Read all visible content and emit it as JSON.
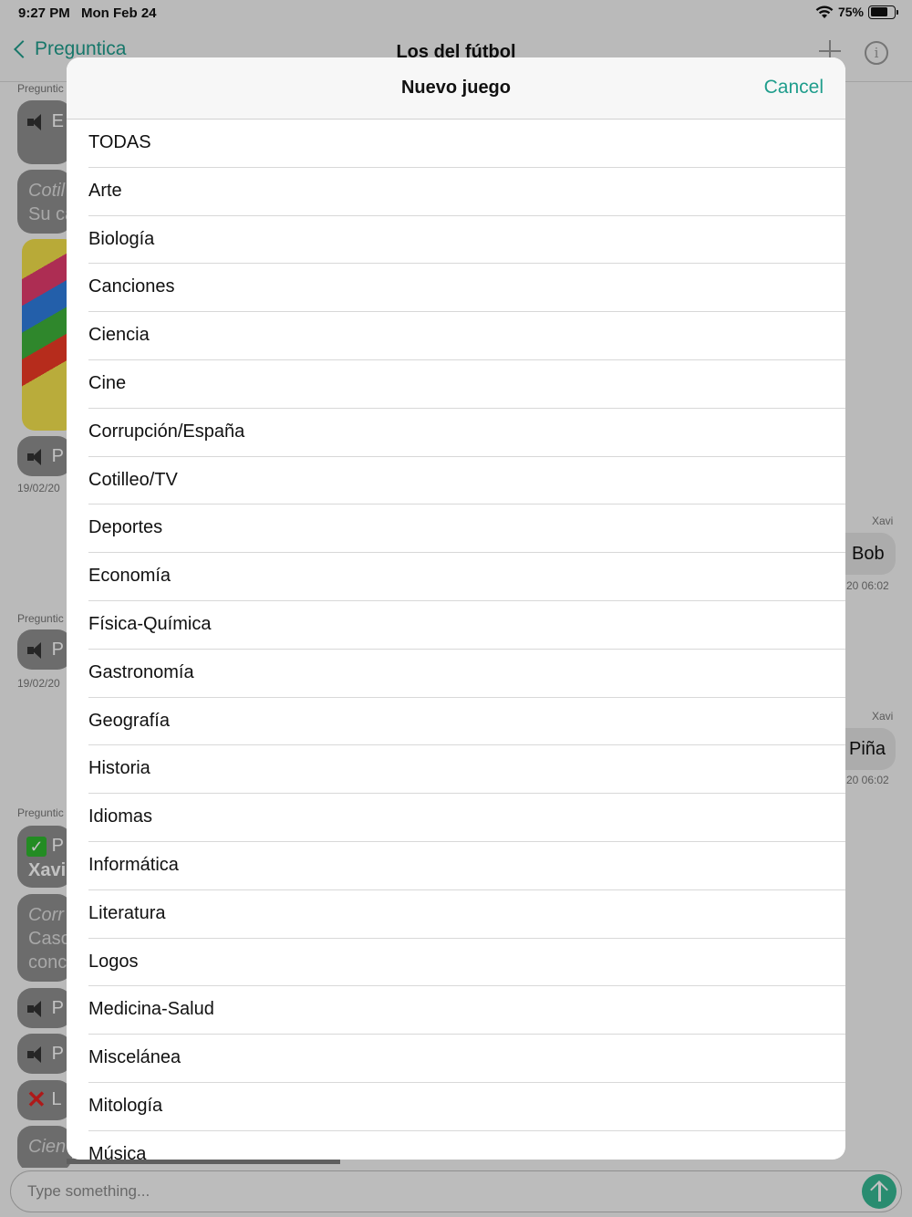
{
  "status_bar": {
    "time": "9:27 PM",
    "date": "Mon Feb 24",
    "battery_text": "75%",
    "battery_level": 0.75
  },
  "nav": {
    "back_label": "Preguntica",
    "title": "Los del fútbol"
  },
  "chat": {
    "left_fragments": [
      {
        "sender": "Preguntic",
        "text": "E"
      },
      {
        "line1": "Cotil",
        "line2": "Su ca"
      },
      {
        "text": "P",
        "timestamp": "19/02/20"
      },
      {
        "sender": "Preguntic",
        "text": "P",
        "timestamp": "19/02/20"
      },
      {
        "sender": "Preguntic",
        "line1": "P",
        "line2": "Xavi"
      },
      {
        "line1": "Corr",
        "line2": "Caso",
        "line3": "conc"
      },
      {
        "text": "P"
      },
      {
        "text": "P"
      },
      {
        "text": "L"
      },
      {
        "text": "Cien"
      }
    ],
    "right_messages": [
      {
        "sender": "Xavi",
        "text": "Bob",
        "timestamp": "20 06:02"
      },
      {
        "sender": "Xavi",
        "text": "Piña",
        "timestamp": "20 06:02"
      }
    ]
  },
  "compose": {
    "placeholder": "Type something..."
  },
  "modal": {
    "title": "Nuevo juego",
    "cancel_label": "Cancel",
    "categories": [
      "TODAS",
      "Arte",
      "Biología",
      "Canciones",
      "Ciencia",
      "Cine",
      "Corrupción/España",
      "Cotilleo/TV",
      "Deportes",
      "Economía",
      "Física-Química",
      "Gastronomía",
      "Geografía",
      "Historia",
      "Idiomas",
      "Informática",
      "Literatura",
      "Logos",
      "Medicina-Salud",
      "Miscelánea",
      "Mitología",
      "Música"
    ]
  },
  "colors": {
    "accent": "#1f9d8c",
    "send_button": "#37b894",
    "bubble_left": "#8e8e8e",
    "bubble_right": "#e2e2e2"
  }
}
